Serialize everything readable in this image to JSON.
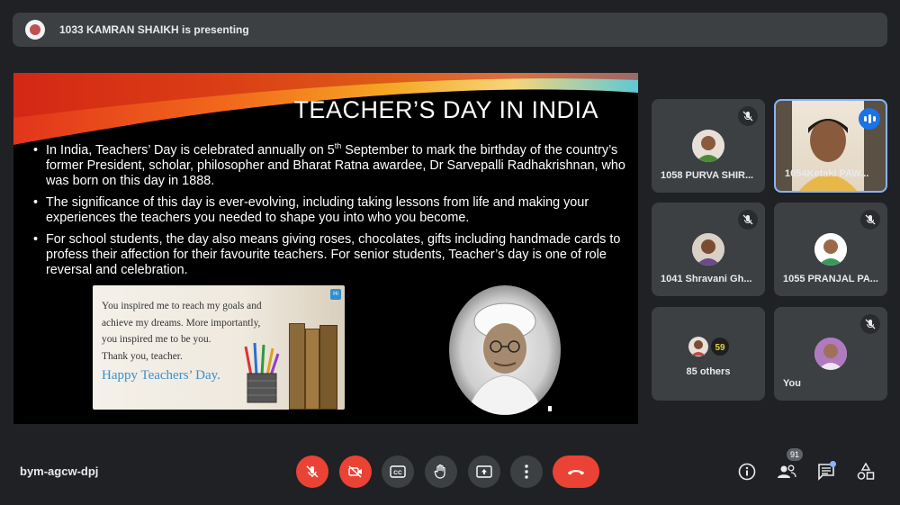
{
  "presenting": {
    "text": "1033 KAMRAN SHAIKH is presenting"
  },
  "slide": {
    "title": "TEACHER’S DAY IN INDIA",
    "bullets": [
      {
        "pre": "In India, Teachers’ Day is celebrated annually on 5",
        "sup": "th",
        "post": " September to mark the birthday of the country’s former President, scholar, philosopher and Bharat Ratna awardee, Dr Sarvepalli Radhakrishnan, who was born on this day in 1888."
      },
      {
        "pre": "The significance of this day is ever-evolving, including taking lessons from life and making your experiences the teachers you needed to shape you into who you become.",
        "sup": "",
        "post": ""
      },
      {
        "pre": "For school students, the day also means giving roses, chocolates, gifts including handmade cards to profess their affection for their favourite teachers. For senior students, Teacher’s day is one of role reversal and celebration.",
        "sup": "",
        "post": ""
      }
    ],
    "card": {
      "lines": [
        "You inspired me to reach my goals and",
        "achieve my dreams. More importantly,",
        "you inspired me to be you.",
        "Thank you, teacher."
      ],
      "happy": "Happy Teachers’ Day.",
      "badge": "Hi"
    }
  },
  "participants": [
    {
      "name": "1058 PURVA SHIR...",
      "muted": true
    },
    {
      "name": "1054Ketaki PAW...",
      "muted": false,
      "speaking": true
    },
    {
      "name": "1041 Shravani Gh...",
      "muted": true
    },
    {
      "name": "1055 PRANJAL PA...",
      "muted": true
    },
    {
      "name": "85 others",
      "muted": false
    },
    {
      "name": "You",
      "muted": true
    }
  ],
  "others_badge": "59",
  "meeting_code": "bym-agcw-dpj",
  "controls": {
    "mic": "mic-off",
    "camera": "camera-off",
    "captions": "CC",
    "hand": "raise-hand",
    "present": "present-now",
    "more": "more-options",
    "end": "end-call"
  },
  "people_count": "91",
  "colors": {
    "accent": "#8ab4f8",
    "danger": "#ea4335",
    "surface": "#3c4043",
    "background": "#202124"
  }
}
